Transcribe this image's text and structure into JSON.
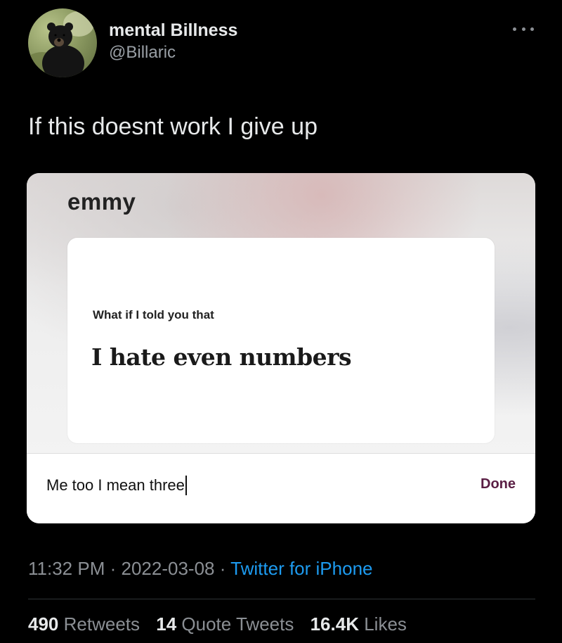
{
  "author": {
    "display_name": "mental Billness",
    "handle": "@Billaric",
    "avatar_icon": "bear-avatar-icon"
  },
  "more_icon": "more-dots-icon",
  "tweet": {
    "text": "If this doesnt work I give up"
  },
  "card": {
    "brand": "emmy",
    "prompt_small": "What if I told you that",
    "prompt_big": "I hate even numbers",
    "input_value": "Me too I mean three",
    "done_label": "Done",
    "accent_color": "#5a1e44"
  },
  "meta": {
    "time": "11:32 PM",
    "date": "2022-03-08",
    "separator": "·",
    "source": "Twitter for iPhone"
  },
  "stats": {
    "retweets_count": "490",
    "retweets_label": "Retweets",
    "quotes_count": "14",
    "quotes_label": "Quote Tweets",
    "likes_count": "16.4K",
    "likes_label": "Likes"
  },
  "colors": {
    "background": "#000000",
    "link": "#1d9bf0",
    "muted_text": "#8b8f94"
  }
}
